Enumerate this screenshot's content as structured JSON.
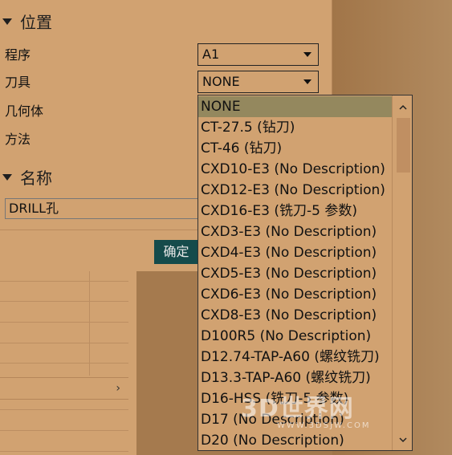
{
  "section_position": {
    "title": "位置"
  },
  "fields": [
    {
      "label": "程序",
      "value": "A1"
    },
    {
      "label": "刀具",
      "value": "NONE"
    },
    {
      "label": "几何体"
    },
    {
      "label": "方法"
    }
  ],
  "section_name": {
    "title": "名称",
    "value": "DRILL孔"
  },
  "ok_button": "确定",
  "dropdown": {
    "items": [
      "NONE",
      "CT-27.5 (钻刀)",
      "CT-46 (钻刀)",
      "CXD10-E3 (No Description)",
      "CXD12-E3 (No Description)",
      "CXD16-E3 (铣刀-5 参数)",
      "CXD3-E3 (No Description)",
      "CXD4-E3 (No Description)",
      "CXD5-E3 (No Description)",
      "CXD6-E3 (No Description)",
      "CXD8-E3 (No Description)",
      "D100R5 (No Description)",
      "D12.74-TAP-A60 (螺纹铣刀)",
      "D13.3-TAP-A60 (螺纹铣刀)",
      "D16-HSS (铣刀-5 参数)",
      "D17 (No Description)",
      "D20 (No Description)"
    ],
    "selected": "NONE"
  },
  "watermark": {
    "logo": "3D世界网",
    "url": "WWW.3DSJW.COM"
  },
  "icons": [
    "chevron-down-icon",
    "chevron-up-icon",
    "chevron-right-icon",
    "collapse-triangle-icon"
  ]
}
